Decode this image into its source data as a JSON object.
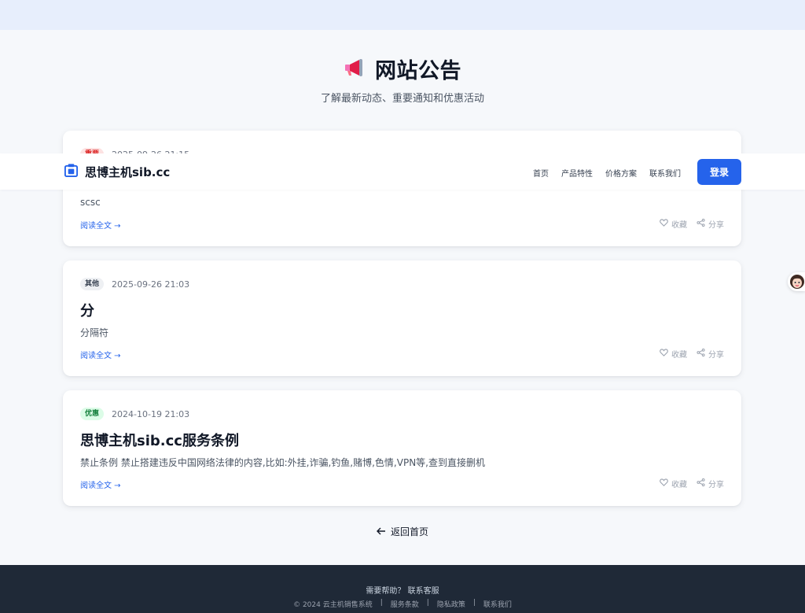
{
  "hero": {
    "title": "网站公告",
    "subtitle": "了解最新动态、重要通知和优惠活动"
  },
  "navbar": {
    "brand": "思博主机sib.cc",
    "links": [
      "首页",
      "产品特性",
      "价格方案",
      "联系我们"
    ],
    "login": "登录"
  },
  "announcements": [
    {
      "badge": "重要",
      "date": "2025-09-26 21:15",
      "title": "",
      "excerpt": "scsc",
      "read_more": "阅读全文 →",
      "favorite": "收藏",
      "share": "分享"
    },
    {
      "badge": "其他",
      "date": "2025-09-26 21:03",
      "title": "分",
      "excerpt": "分隔符",
      "read_more": "阅读全文 →",
      "favorite": "收藏",
      "share": "分享"
    },
    {
      "badge": "优惠",
      "date": "2024-10-19 21:03",
      "title": "思博主机sib.cc服务条例",
      "excerpt": "禁止条例 禁止搭建违反中国网络法律的内容,比如:外挂,诈骗,钓鱼,赌博,色情,VPN等,查到直接删机",
      "read_more": "阅读全文 →",
      "favorite": "收藏",
      "share": "分享"
    }
  ],
  "back_home": "返回首页",
  "footer": {
    "help": "需要帮助？ 联系客服",
    "copyright": "© 2024 云主机销售系统",
    "links": [
      "服务条款",
      "隐私政策",
      "联系我们"
    ],
    "separator": "|"
  },
  "colors": {
    "accent": "#2563eb",
    "footer_bg": "#1f2937",
    "badge_important": "#dc2626",
    "badge_promo": "#15803d"
  },
  "icons": {
    "hero": "megaphone-icon",
    "brand": "server-box-icon",
    "favorite": "heart-icon",
    "share": "share-icon",
    "back": "arrow-left-icon"
  }
}
